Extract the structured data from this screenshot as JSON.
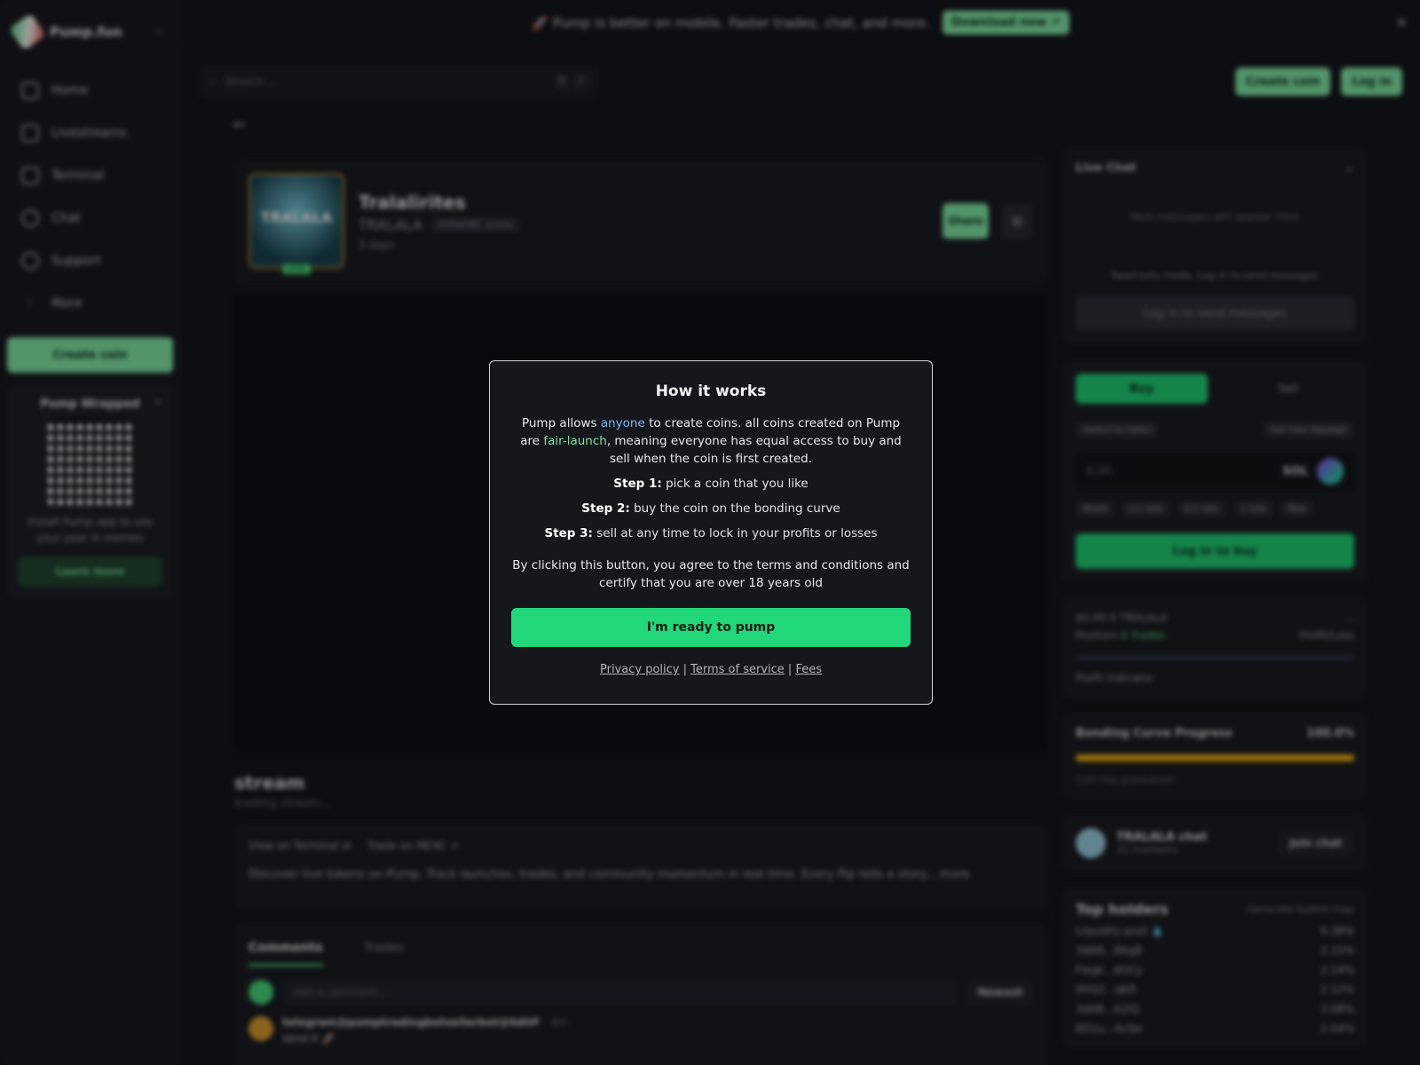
{
  "sidebar": {
    "brand": "Pump.fun",
    "nav": [
      {
        "label": "Home"
      },
      {
        "label": "Livestreams"
      },
      {
        "label": "Terminal"
      },
      {
        "label": "Chat"
      },
      {
        "label": "Support"
      },
      {
        "label": "More"
      }
    ],
    "create_coin": "Create coin",
    "wrapped": {
      "title": "Pump Wrapped",
      "text": "Install Pump app to see your year in memes",
      "button": "Learn more"
    }
  },
  "banner": {
    "text": "🚀 Pump is better on mobile. Faster trades, chat, and more.",
    "button": "Download now ↗",
    "close": "✕"
  },
  "topbar": {
    "search_placeholder": "Search...",
    "create_coin": "Create coin",
    "login": "Log in"
  },
  "coin": {
    "name": "Tralalirites",
    "ticker": "TRALALA",
    "address": "9VRwDBf...pump",
    "creator": "3 days",
    "image_label": "TRALALA",
    "badge": "LIVE",
    "share": "Share",
    "back": "⇐"
  },
  "stream": {
    "title": "stream",
    "subtitle": "loading stream...",
    "links": [
      "View on Terminal ⇄",
      "Trade on MEXC ↗"
    ],
    "description": "Discover live tokens on Pump. Track launches, trades, and community momentum in real time. Every flip tells a story... more"
  },
  "comments": {
    "tabs": [
      "Comments",
      "Trades"
    ],
    "placeholder": "Add a comment...",
    "sort": "Newest",
    "first": {
      "user": "telegram@pumptradingbotsellerbot@6dUF",
      "time": "4m",
      "text": "send it 🚀"
    }
  },
  "chat": {
    "title": "Live Chat",
    "empty": "New messages will appear here",
    "note": "Read-only mode. Log in to send messages",
    "login": "Log in to send messages"
  },
  "trade": {
    "buy": "Buy",
    "sell": "Sell",
    "switch": "Switch to token",
    "slippage": "Set max slippage",
    "amount_placeholder": "0.00",
    "unit": "SOL",
    "quick": [
      "Reset",
      "0.1 SOL",
      "0.5 SOL",
      "1 SOL",
      "Max"
    ],
    "login": "Log in to buy"
  },
  "position": {
    "value": "$0.00  0 TRALALA",
    "label": "Position",
    "trades": "0 Trades",
    "profit": "Profit/Loss",
    "indicator": "Profit indicator"
  },
  "bonding": {
    "title": "Bonding Curve Progress",
    "value": "100.0%",
    "progress": 1.0,
    "note": "Coin has graduated!"
  },
  "group_chat": {
    "name": "TRALALA chat",
    "members": "32 members",
    "join": "Join chat"
  },
  "holders": {
    "title": "Top holders",
    "action": "Generate bubble map",
    "rows": [
      {
        "name": "Liquidity pool 💧",
        "pct": "9.38%"
      },
      {
        "name": "3dAB...B6gB",
        "pct": "2.15%"
      },
      {
        "name": "Fwgk...4GCy",
        "pct": "2.14%"
      },
      {
        "name": "9XQ2...qbft",
        "pct": "2.12%"
      },
      {
        "name": "3dAB...A2iQ",
        "pct": "2.08%"
      },
      {
        "name": "8D1u...AcQe",
        "pct": "2.04%"
      }
    ]
  },
  "modal": {
    "title": "How it works",
    "intro_before": "Pump allows ",
    "intro_anyone": "anyone",
    "intro_middle": " to create coins. all coins created on Pump are ",
    "intro_fair": "fair-launch",
    "intro_after": ", meaning everyone has equal access to buy and sell when the coin is first created.",
    "steps": [
      {
        "label": "Step 1:",
        "text": " pick a coin that you like"
      },
      {
        "label": "Step 2:",
        "text": " buy the coin on the bonding curve"
      },
      {
        "label": "Step 3:",
        "text": " sell at any time to lock in your profits or losses"
      }
    ],
    "terms": "By clicking this button, you agree to the terms and conditions and certify that you are over 18 years old",
    "button": "I'm ready to pump",
    "links": [
      "Privacy policy",
      "Terms of service",
      "Fees"
    ],
    "separator": " | "
  }
}
